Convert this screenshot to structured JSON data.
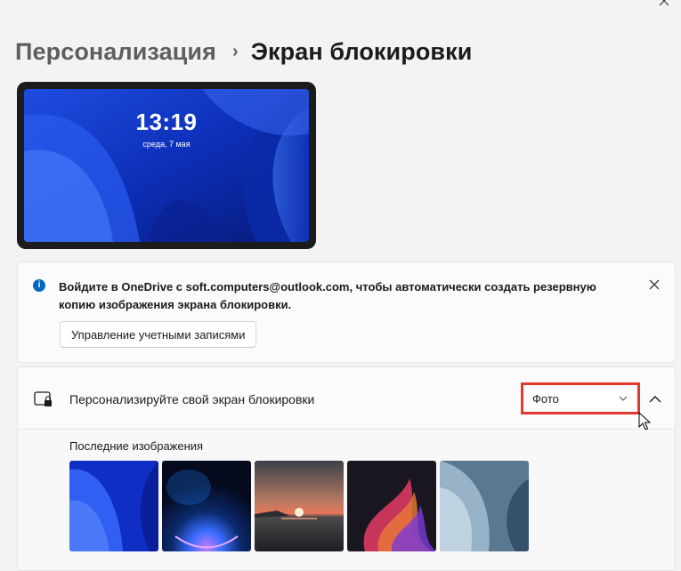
{
  "header": {
    "breadcrumb_parent": "Персонализация",
    "breadcrumb_separator": "›",
    "breadcrumb_current": "Экран блокировки"
  },
  "preview": {
    "time": "13:19",
    "date": "среда, 7 мая"
  },
  "onedrive_notice": {
    "text": "Войдите в OneDrive с soft.computers@outlook.com, чтобы автоматически создать резервную копию изображения экрана блокировки.",
    "button_label": "Управление учетными записями",
    "icon": "info-icon",
    "close_icon": "close-icon"
  },
  "personalize": {
    "title": "Персонализируйте свой экран блокировки",
    "dropdown_value": "Фото",
    "recent_images_label": "Последние изображения",
    "thumbnails": [
      "blue-bloom",
      "dark-glow",
      "sunset-sea",
      "colorful-ribbon",
      "gray-bloom"
    ]
  },
  "colors": {
    "accent": "#0067c0",
    "highlight": "#e03a2f",
    "background": "#f3f3f3"
  }
}
